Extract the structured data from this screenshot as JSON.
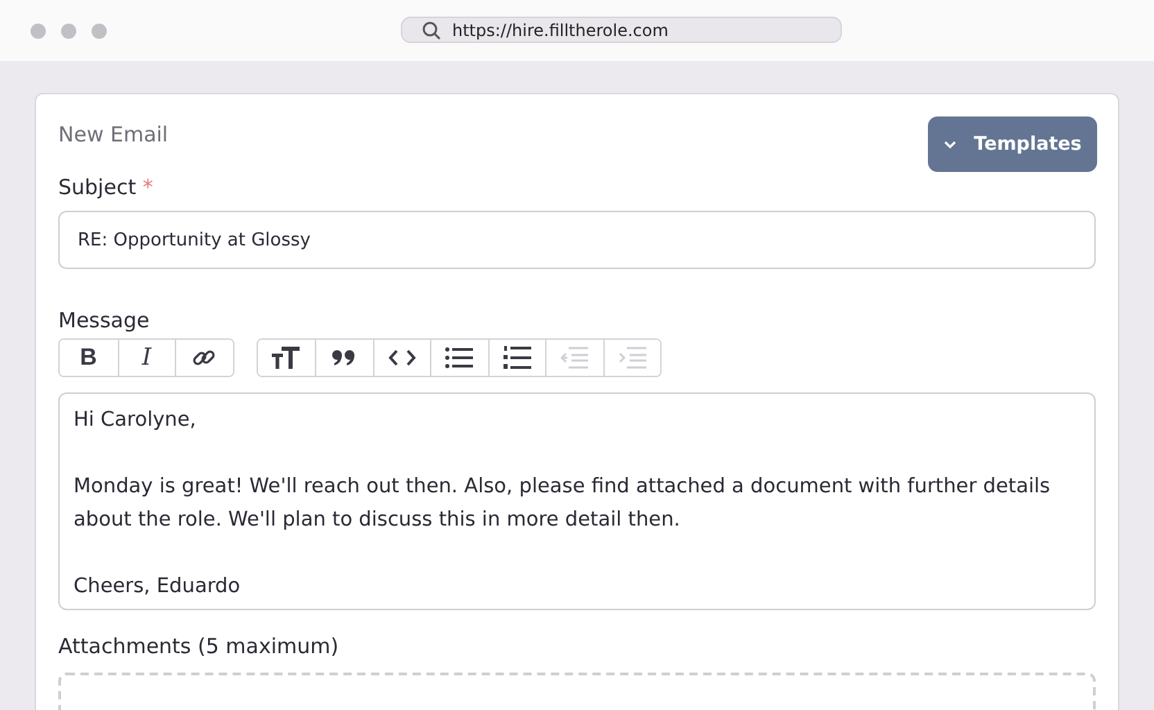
{
  "browser": {
    "url": "https://hire.filltherole.com"
  },
  "email": {
    "title": "New Email",
    "templates_button": "Templates",
    "subject": {
      "label": "Subject",
      "required_mark": "*",
      "value": "RE: Opportunity at Glossy"
    },
    "message": {
      "label": "Message",
      "toolbar": [
        [
          {
            "kind": "bold",
            "label": "B",
            "disabled": false
          },
          {
            "kind": "italic",
            "label": "I",
            "disabled": false
          },
          {
            "kind": "link",
            "disabled": false
          }
        ],
        [
          {
            "kind": "heading",
            "disabled": false
          },
          {
            "kind": "quote",
            "disabled": false
          },
          {
            "kind": "code",
            "disabled": false
          },
          {
            "kind": "bullets",
            "disabled": false
          },
          {
            "kind": "numbers",
            "disabled": false
          },
          {
            "kind": "outdent",
            "disabled": true
          },
          {
            "kind": "indent",
            "disabled": true
          }
        ]
      ],
      "paragraphs": [
        "Hi Carolyne,",
        "Monday is great! We'll reach out then. Also, please find attached a document with further details about the role. We'll plan to discuss this in more detail then.",
        "Cheers, Eduardo"
      ]
    },
    "attachments": {
      "label": "Attachments (5 maximum)"
    }
  }
}
